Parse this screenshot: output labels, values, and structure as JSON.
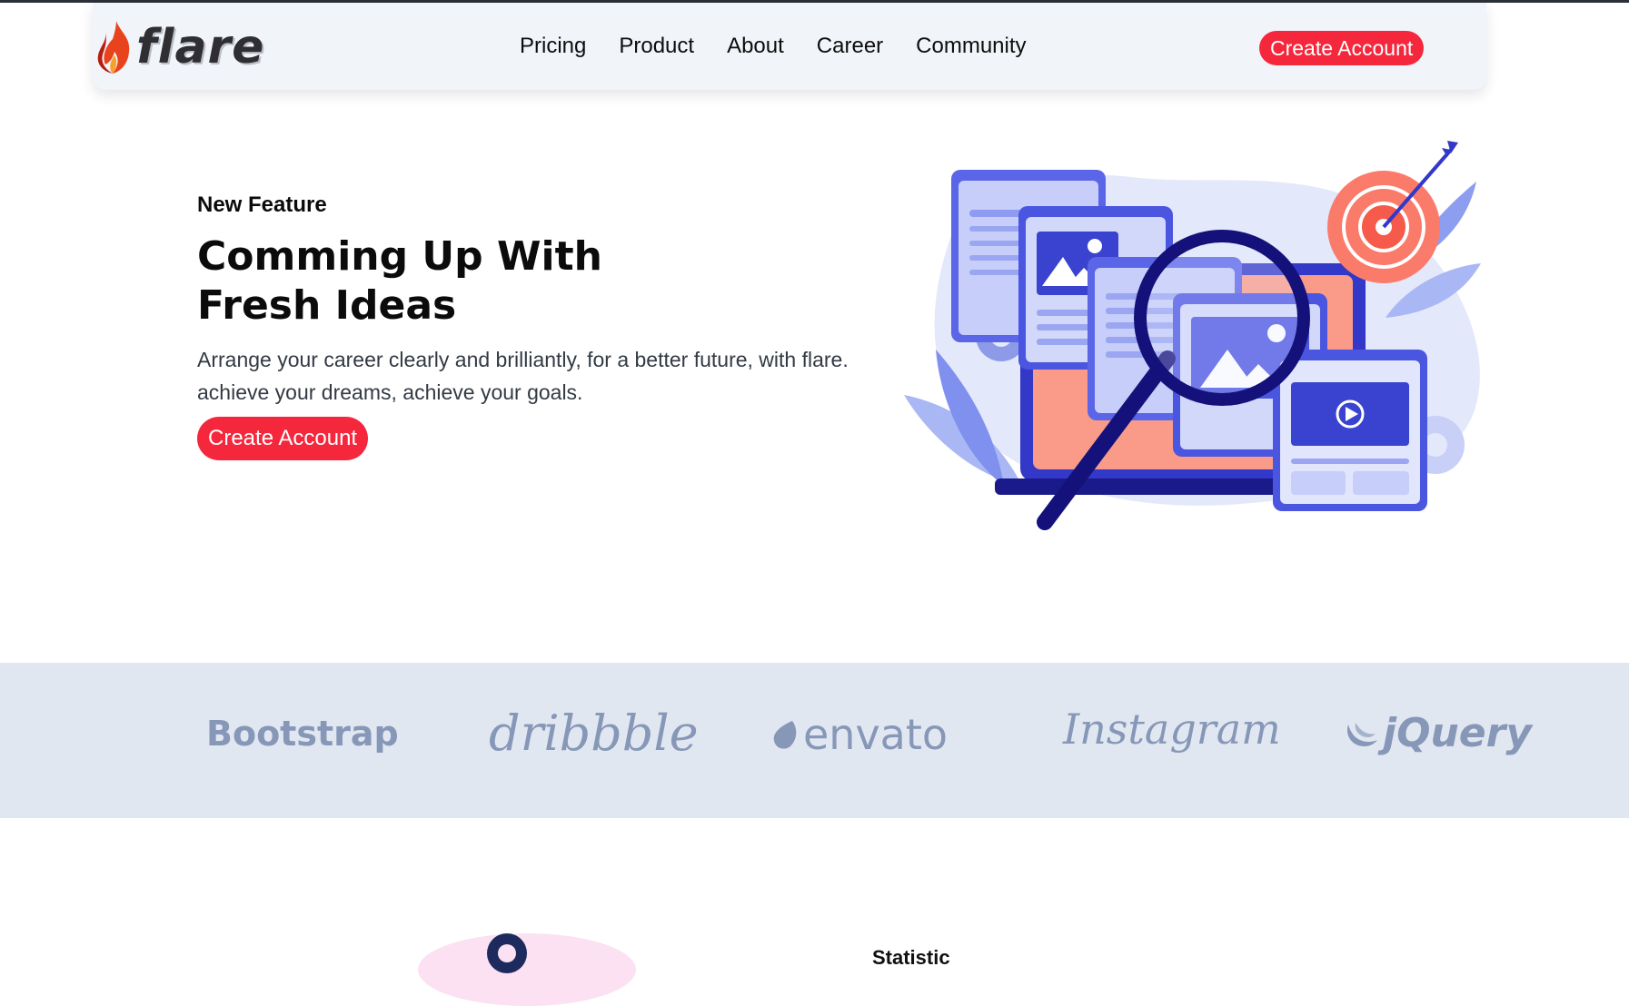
{
  "brand": {
    "name": "flare",
    "icon": "flame-icon"
  },
  "nav": {
    "links": [
      "Pricing",
      "Product",
      "About",
      "Career",
      "Community"
    ],
    "cta_label": "Create Account"
  },
  "hero": {
    "eyebrow": "New Feature",
    "title_line1": "Comming Up With",
    "title_line2": "Fresh Ideas",
    "subtitle": "Arrange your career clearly and brilliantly, for a better future, with flare. achieve your dreams, achieve your goals.",
    "cta_label": "Create Account"
  },
  "partners": [
    "Bootstrap",
    "dribbble",
    "envato",
    "Instagram",
    "jQuery"
  ],
  "next_section": {
    "label": "Statistic"
  },
  "colors": {
    "accent": "#f4273c",
    "navbar_bg": "#f1f4f9",
    "brand_strip_bg": "#e1e7f0",
    "brand_logo": "#8697b8",
    "illustration_primary": "#4a55e0",
    "illustration_dark": "#14127a",
    "illustration_coral": "#fa9b8a"
  }
}
